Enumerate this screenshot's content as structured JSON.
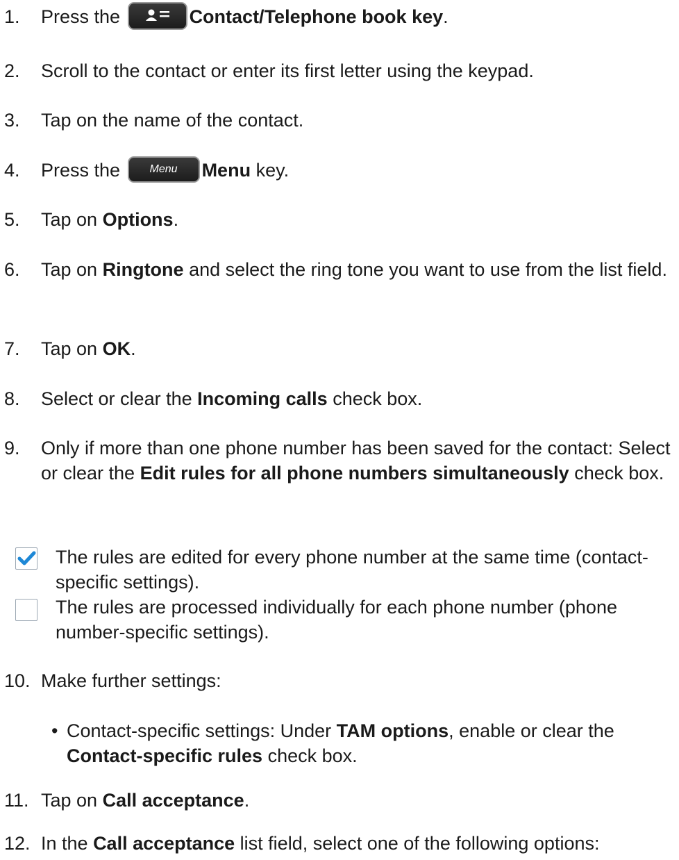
{
  "steps": [
    {
      "n": "1.",
      "pre": "Press the ",
      "key": "contact",
      "bold": "Contact/Telephone book key",
      "post": "."
    },
    {
      "n": "2.",
      "text": "Scroll to the contact or enter its first letter using the keypad."
    },
    {
      "n": "3.",
      "text": "Tap on the name of the contact."
    },
    {
      "n": "4.",
      "pre": "Press the ",
      "key": "menu",
      "bold": "Menu",
      "post": " key."
    },
    {
      "n": "5.",
      "pre": "Tap on ",
      "bold": "Options",
      "post": "."
    },
    {
      "n": "6.",
      "pre": "Tap on ",
      "bold": "Ringtone",
      "post": " and select the ring tone you want to use from the list field."
    },
    {
      "n": "7.",
      "pre": "Tap on ",
      "bold": "OK",
      "post": "."
    },
    {
      "n": "8.",
      "pre": "Select or clear the ",
      "bold": "Incoming calls",
      "post": " check box."
    },
    {
      "n": "9.",
      "pre": "Only if more than one phone number has been saved for the contact: Select or clear the ",
      "bold": "Edit rules for all phone numbers simultaneously",
      "post": " check box."
    },
    {
      "n": "10.",
      "text": "Make further settings:"
    },
    {
      "n": "11.",
      "pre": "Tap on ",
      "bold": "Call acceptance",
      "post": "."
    },
    {
      "n": "12.",
      "pre": "In the ",
      "bold": "Call acceptance",
      "post": " list field, select one of the following options:"
    }
  ],
  "menu_key_label": "Menu",
  "checkbox_options": [
    {
      "checked": true,
      "text": "The rules are edited for every phone number at the same time (contact-specific settings)."
    },
    {
      "checked": false,
      "text": "The rules are processed individually for each phone number (phone number-specific settings)."
    }
  ],
  "bullet": {
    "pre": "Contact-specific settings: Under ",
    "bold1": "TAM options",
    "mid": ", enable or clear the ",
    "bold2": "Contact-specific rules",
    "post": " check box."
  },
  "colors": {
    "check": "#1e88d6",
    "text": "#1a1a1a"
  }
}
